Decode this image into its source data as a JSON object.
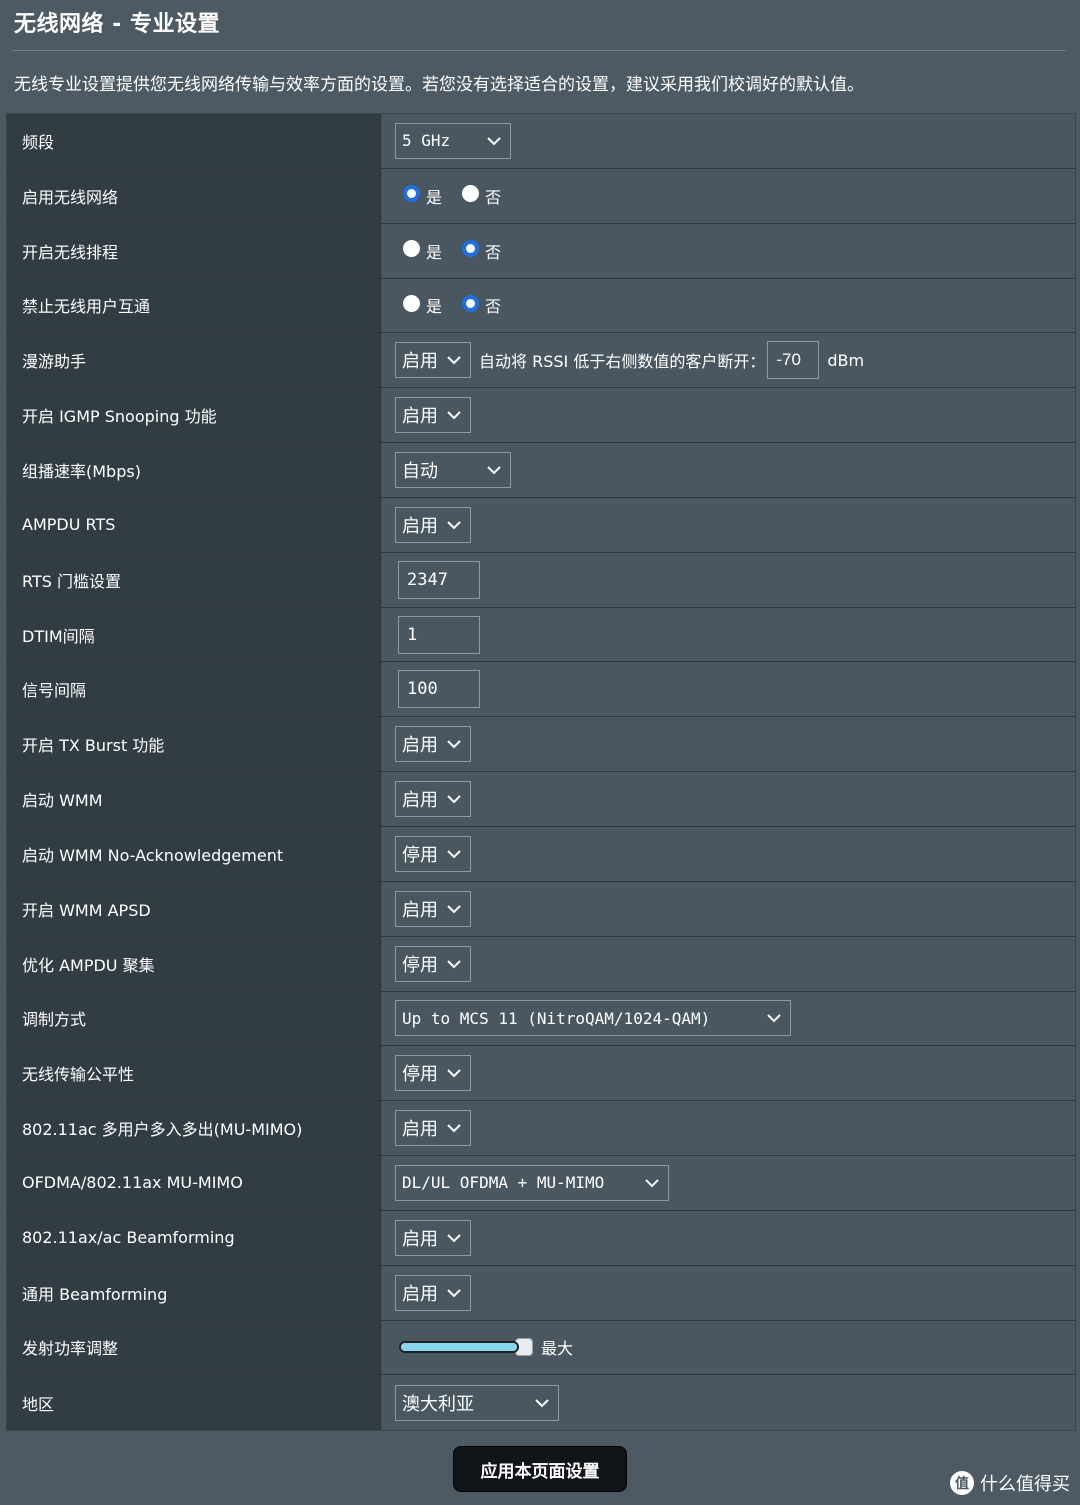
{
  "header": {
    "title": "无线网络 - 专业设置",
    "description": "无线专业设置提供您无线网络传输与效率方面的设置。若您没有选择适合的设置，建议采用我们校调好的默认值。"
  },
  "rows": [
    {
      "label": "频段",
      "type": "select",
      "value": "5 GHz",
      "mono": true,
      "width": "wide"
    },
    {
      "label": "启用无线网络",
      "type": "radio",
      "yes": "是",
      "no": "否",
      "selected": "yes"
    },
    {
      "label": "开启无线排程",
      "type": "radio",
      "yes": "是",
      "no": "否",
      "selected": "no"
    },
    {
      "label": "禁止无线用户互通",
      "type": "radio",
      "yes": "是",
      "no": "否",
      "selected": "no"
    },
    {
      "label": "漫游助手",
      "type": "roaming",
      "value": "启用",
      "text": "自动将 RSSI 低于右侧数值的客户断开：",
      "rssi": "-70",
      "unit": "dBm"
    },
    {
      "label": "开启 IGMP Snooping 功能",
      "type": "select",
      "value": "启用"
    },
    {
      "label": "组播速率(Mbps)",
      "type": "select",
      "value": "自动",
      "width": "wide"
    },
    {
      "label": "AMPDU RTS",
      "type": "select",
      "value": "启用"
    },
    {
      "label": "RTS 门槛设置",
      "type": "input",
      "value": "2347"
    },
    {
      "label": "DTIM间隔",
      "type": "input",
      "value": "1"
    },
    {
      "label": "信号间隔",
      "type": "input",
      "value": "100"
    },
    {
      "label": "开启 TX Burst 功能",
      "type": "select",
      "value": "启用"
    },
    {
      "label": "启动 WMM",
      "type": "select",
      "value": "启用"
    },
    {
      "label": "启动 WMM No-Acknowledgement",
      "type": "select",
      "value": "停用"
    },
    {
      "label": "开启 WMM APSD",
      "type": "select",
      "value": "启用"
    },
    {
      "label": "优化 AMPDU 聚集",
      "type": "select",
      "value": "停用"
    },
    {
      "label": "调制方式",
      "type": "select",
      "value": "Up to MCS 11 (NitroQAM/1024-QAM)",
      "mono": true,
      "width": "xwide"
    },
    {
      "label": "无线传输公平性",
      "type": "select",
      "value": "停用"
    },
    {
      "label": "802.11ac 多用户多入多出(MU-MIMO)",
      "type": "select",
      "value": "启用"
    },
    {
      "label": "OFDMA/802.11ax MU-MIMO",
      "type": "select",
      "value": "DL/UL OFDMA + MU-MIMO",
      "mono": true,
      "width": "lwide"
    },
    {
      "label": "802.11ax/ac Beamforming",
      "type": "select",
      "value": "启用"
    },
    {
      "label": "通用 Beamforming",
      "type": "select",
      "value": "启用"
    },
    {
      "label": "发射功率调整",
      "type": "slider",
      "level": 1.0,
      "text": "最大"
    },
    {
      "label": "地区",
      "type": "select",
      "value": "澳大利亚",
      "width": "region"
    }
  ],
  "apply_button": {
    "label": "应用本页面设置"
  },
  "watermark": {
    "logo": "值",
    "text": "什么值得买"
  },
  "colors": {
    "accent": "#1f6fe0",
    "slider": "#88d6ee",
    "button": "#111418"
  }
}
